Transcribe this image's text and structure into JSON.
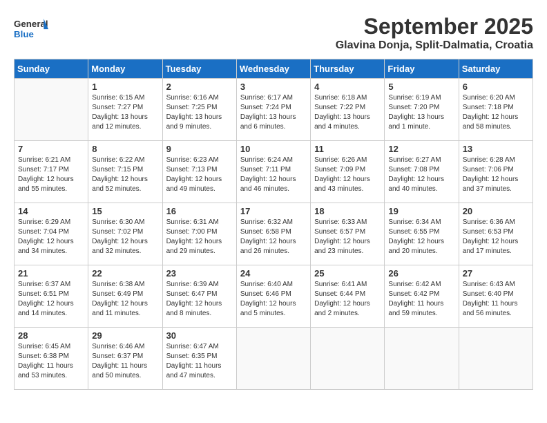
{
  "header": {
    "logo_general": "General",
    "logo_blue": "Blue",
    "month": "September 2025",
    "location": "Glavina Donja, Split-Dalmatia, Croatia"
  },
  "weekdays": [
    "Sunday",
    "Monday",
    "Tuesday",
    "Wednesday",
    "Thursday",
    "Friday",
    "Saturday"
  ],
  "weeks": [
    [
      {
        "day": "",
        "info": ""
      },
      {
        "day": "1",
        "info": "Sunrise: 6:15 AM\nSunset: 7:27 PM\nDaylight: 13 hours\nand 12 minutes."
      },
      {
        "day": "2",
        "info": "Sunrise: 6:16 AM\nSunset: 7:25 PM\nDaylight: 13 hours\nand 9 minutes."
      },
      {
        "day": "3",
        "info": "Sunrise: 6:17 AM\nSunset: 7:24 PM\nDaylight: 13 hours\nand 6 minutes."
      },
      {
        "day": "4",
        "info": "Sunrise: 6:18 AM\nSunset: 7:22 PM\nDaylight: 13 hours\nand 4 minutes."
      },
      {
        "day": "5",
        "info": "Sunrise: 6:19 AM\nSunset: 7:20 PM\nDaylight: 13 hours\nand 1 minute."
      },
      {
        "day": "6",
        "info": "Sunrise: 6:20 AM\nSunset: 7:18 PM\nDaylight: 12 hours\nand 58 minutes."
      }
    ],
    [
      {
        "day": "7",
        "info": "Sunrise: 6:21 AM\nSunset: 7:17 PM\nDaylight: 12 hours\nand 55 minutes."
      },
      {
        "day": "8",
        "info": "Sunrise: 6:22 AM\nSunset: 7:15 PM\nDaylight: 12 hours\nand 52 minutes."
      },
      {
        "day": "9",
        "info": "Sunrise: 6:23 AM\nSunset: 7:13 PM\nDaylight: 12 hours\nand 49 minutes."
      },
      {
        "day": "10",
        "info": "Sunrise: 6:24 AM\nSunset: 7:11 PM\nDaylight: 12 hours\nand 46 minutes."
      },
      {
        "day": "11",
        "info": "Sunrise: 6:26 AM\nSunset: 7:09 PM\nDaylight: 12 hours\nand 43 minutes."
      },
      {
        "day": "12",
        "info": "Sunrise: 6:27 AM\nSunset: 7:08 PM\nDaylight: 12 hours\nand 40 minutes."
      },
      {
        "day": "13",
        "info": "Sunrise: 6:28 AM\nSunset: 7:06 PM\nDaylight: 12 hours\nand 37 minutes."
      }
    ],
    [
      {
        "day": "14",
        "info": "Sunrise: 6:29 AM\nSunset: 7:04 PM\nDaylight: 12 hours\nand 34 minutes."
      },
      {
        "day": "15",
        "info": "Sunrise: 6:30 AM\nSunset: 7:02 PM\nDaylight: 12 hours\nand 32 minutes."
      },
      {
        "day": "16",
        "info": "Sunrise: 6:31 AM\nSunset: 7:00 PM\nDaylight: 12 hours\nand 29 minutes."
      },
      {
        "day": "17",
        "info": "Sunrise: 6:32 AM\nSunset: 6:58 PM\nDaylight: 12 hours\nand 26 minutes."
      },
      {
        "day": "18",
        "info": "Sunrise: 6:33 AM\nSunset: 6:57 PM\nDaylight: 12 hours\nand 23 minutes."
      },
      {
        "day": "19",
        "info": "Sunrise: 6:34 AM\nSunset: 6:55 PM\nDaylight: 12 hours\nand 20 minutes."
      },
      {
        "day": "20",
        "info": "Sunrise: 6:36 AM\nSunset: 6:53 PM\nDaylight: 12 hours\nand 17 minutes."
      }
    ],
    [
      {
        "day": "21",
        "info": "Sunrise: 6:37 AM\nSunset: 6:51 PM\nDaylight: 12 hours\nand 14 minutes."
      },
      {
        "day": "22",
        "info": "Sunrise: 6:38 AM\nSunset: 6:49 PM\nDaylight: 12 hours\nand 11 minutes."
      },
      {
        "day": "23",
        "info": "Sunrise: 6:39 AM\nSunset: 6:47 PM\nDaylight: 12 hours\nand 8 minutes."
      },
      {
        "day": "24",
        "info": "Sunrise: 6:40 AM\nSunset: 6:46 PM\nDaylight: 12 hours\nand 5 minutes."
      },
      {
        "day": "25",
        "info": "Sunrise: 6:41 AM\nSunset: 6:44 PM\nDaylight: 12 hours\nand 2 minutes."
      },
      {
        "day": "26",
        "info": "Sunrise: 6:42 AM\nSunset: 6:42 PM\nDaylight: 11 hours\nand 59 minutes."
      },
      {
        "day": "27",
        "info": "Sunrise: 6:43 AM\nSunset: 6:40 PM\nDaylight: 11 hours\nand 56 minutes."
      }
    ],
    [
      {
        "day": "28",
        "info": "Sunrise: 6:45 AM\nSunset: 6:38 PM\nDaylight: 11 hours\nand 53 minutes."
      },
      {
        "day": "29",
        "info": "Sunrise: 6:46 AM\nSunset: 6:37 PM\nDaylight: 11 hours\nand 50 minutes."
      },
      {
        "day": "30",
        "info": "Sunrise: 6:47 AM\nSunset: 6:35 PM\nDaylight: 11 hours\nand 47 minutes."
      },
      {
        "day": "",
        "info": ""
      },
      {
        "day": "",
        "info": ""
      },
      {
        "day": "",
        "info": ""
      },
      {
        "day": "",
        "info": ""
      }
    ]
  ]
}
